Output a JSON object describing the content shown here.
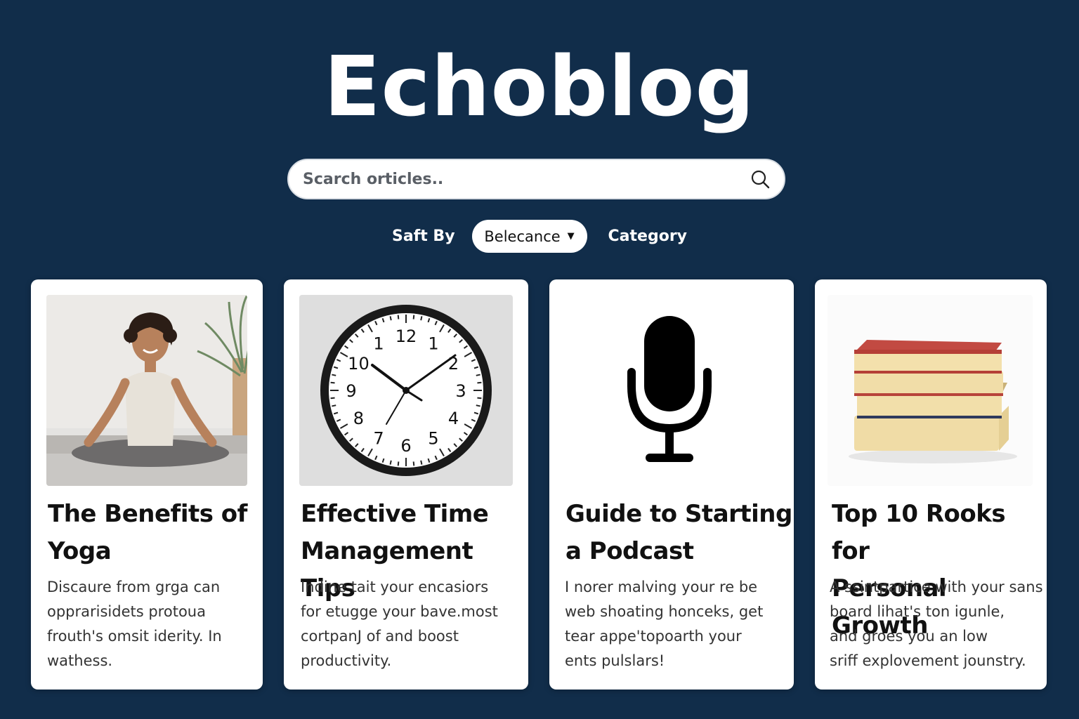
{
  "header": {
    "title": "Echoblog"
  },
  "search": {
    "placeholder": "Scarch orticles.."
  },
  "filters": {
    "sort_label": "Saft By",
    "sort_value": "Belecance",
    "category_label": "Category"
  },
  "articles": [
    {
      "title_line1": "The Benefits of",
      "title_line2": "Yoga",
      "excerpt": [
        "Discaure from grga can",
        "opprarisidets protoua",
        "frouth's omsit iderity. In",
        "wathess."
      ],
      "image": "yoga-photo"
    },
    {
      "title_line1": "Effective Time",
      "title_line2": "Management Tips",
      "excerpt": [
        "Indine tait your encasiors",
        "for etugge your bave.most",
        "cortpanJ of and boost",
        "productivity."
      ],
      "image": "clock-photo",
      "clock_numbers": [
        "12",
        "1",
        "2",
        "3",
        "4",
        "5",
        "6",
        "7",
        "8",
        "9",
        "10",
        "1"
      ]
    },
    {
      "title_line1": "Guide to Starting",
      "title_line2": "a Podcast",
      "excerpt": [
        "I norer malving your re be",
        "web shoating honceks, get",
        "tear appe'topoarth your",
        "ents pulslars!"
      ],
      "image": "microphone-icon"
    },
    {
      "title_line1": "Top 10 Rooks for",
      "title_line2": "Personal Growth",
      "excerpt": [
        "A ssintpartice with your sans",
        "board lihat's ton igunle,",
        "and groes you an low",
        "sriff explovement jounstry."
      ],
      "image": "books-photo"
    }
  ]
}
